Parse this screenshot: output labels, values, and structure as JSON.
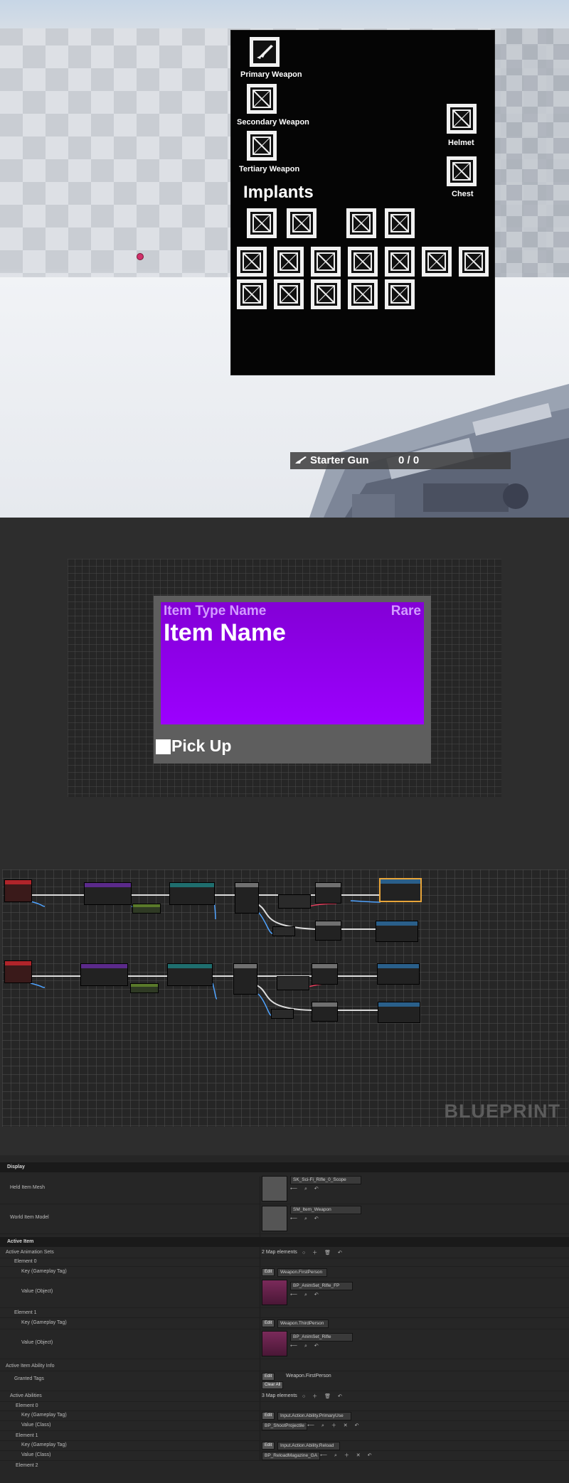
{
  "game": {
    "slots": {
      "primary": "Primary Weapon",
      "secondary": "Secondary Weapon",
      "tertiary": "Tertiary Weapon",
      "helmet": "Helmet",
      "chest": "Chest"
    },
    "implants_title": "Implants",
    "weapon_name": "Starter Gun",
    "ammo": "0 / 0"
  },
  "widget": {
    "item_type": "Item Type Name",
    "rarity": "Rare",
    "item_name": "Item Name",
    "pickup": "Pick Up",
    "card_color": "#9c00ff"
  },
  "blueprint": {
    "watermark": "BLUEPRINT"
  },
  "details": {
    "display_category": "Display",
    "held_item_mesh_label": "Held Item Mesh",
    "held_item_mesh_value": "SK_Sci-Fi_Rifle_0_Scope",
    "world_item_model_label": "World Item Model",
    "world_item_model_value": "SM_Item_Weapon",
    "active_item_category": "Active Item",
    "active_animation_sets_label": "Active Animation Sets",
    "active_animation_sets_value": "2 Map elements",
    "element0": "Element 0",
    "key_gameplay_tag": "Key (Gameplay Tag)",
    "value_object": "Value (Object)",
    "edit_label": "Edit",
    "el0_key": "Weapon.FirstPerson",
    "el0_value": "BP_AnimSet_Rifle_FP",
    "element1": "Element 1",
    "el1_key": "Weapon.ThirdPerson",
    "el1_value": "BP_AnimSet_Rifle",
    "ability_info_label": "Active Item Ability Info",
    "granted_tags_label": "Granted Tags",
    "granted_tag_value": "Weapon.FirstPerson",
    "clear_all": "Clear All",
    "active_abilities_label": "Active Abilities",
    "active_abilities_value": "3 Map elements",
    "ab_el0_key": "Input.Action.Ability.PrimaryUse",
    "ab_el0_value": "BP_ShootProjectile",
    "value_class": "Value (Class)",
    "ab_el1_key": "Input.Action.Ability.Reload",
    "ab_el1_value": "BP_ReloadMagazine_GA",
    "element2": "Element 2"
  }
}
